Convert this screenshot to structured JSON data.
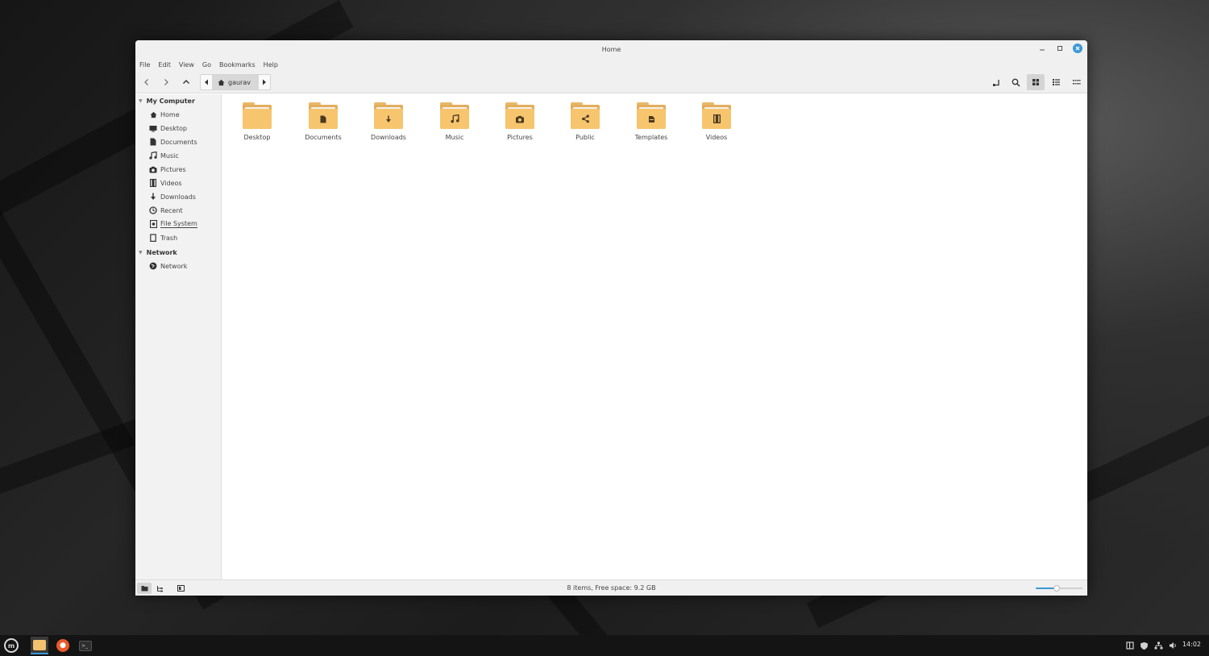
{
  "window": {
    "title": "Home"
  },
  "menubar": [
    "File",
    "Edit",
    "View",
    "Go",
    "Bookmarks",
    "Help"
  ],
  "pathbar": {
    "crumb": "gaurav"
  },
  "sidebar": {
    "sections": [
      {
        "label": "My Computer",
        "items": [
          {
            "label": "Home",
            "icon": "home-icon"
          },
          {
            "label": "Desktop",
            "icon": "desktop-icon"
          },
          {
            "label": "Documents",
            "icon": "document-icon"
          },
          {
            "label": "Music",
            "icon": "music-icon"
          },
          {
            "label": "Pictures",
            "icon": "camera-icon"
          },
          {
            "label": "Videos",
            "icon": "film-icon"
          },
          {
            "label": "Downloads",
            "icon": "download-icon"
          },
          {
            "label": "Recent",
            "icon": "clock-icon"
          },
          {
            "label": "File System",
            "icon": "drive-icon"
          },
          {
            "label": "Trash",
            "icon": "trash-icon"
          }
        ]
      },
      {
        "label": "Network",
        "items": [
          {
            "label": "Network",
            "icon": "network-icon"
          }
        ]
      }
    ]
  },
  "files": [
    {
      "label": "Desktop",
      "emblem": ""
    },
    {
      "label": "Documents",
      "emblem": "document"
    },
    {
      "label": "Downloads",
      "emblem": "download"
    },
    {
      "label": "Music",
      "emblem": "music"
    },
    {
      "label": "Pictures",
      "emblem": "camera"
    },
    {
      "label": "Public",
      "emblem": "share"
    },
    {
      "label": "Templates",
      "emblem": "template"
    },
    {
      "label": "Videos",
      "emblem": "film"
    }
  ],
  "statusbar": {
    "text": "8 items, Free space: 9.2 GB",
    "zoom_level": 0.45
  },
  "taskbar": {
    "clock": "14:02"
  },
  "colors": {
    "accent": "#3b98d7",
    "folder": "#f6c56e"
  }
}
